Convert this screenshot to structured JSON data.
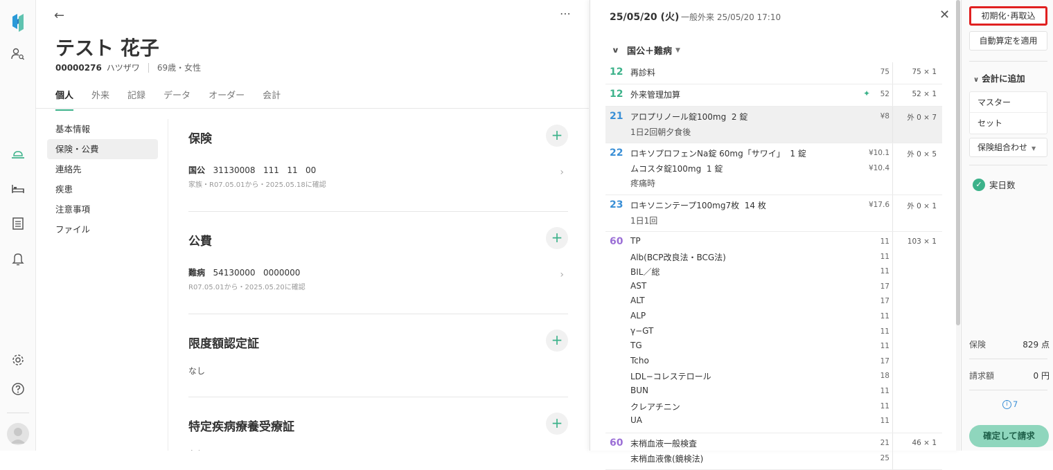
{
  "patient": {
    "name": "テスト 花子",
    "id": "00000276",
    "kana": "ハツザワ",
    "age_sex": "69歳・女性",
    "tabs": [
      "個人",
      "外来",
      "記録",
      "データ",
      "オーダー",
      "会計"
    ],
    "subnav": [
      "基本情報",
      "保険・公費",
      "連絡先",
      "疾患",
      "注意事項",
      "ファイル"
    ],
    "sections": {
      "insurance": {
        "title": "保険",
        "type": "国公",
        "numbers": "31130008   111   11   00",
        "sub": "家族・R07.05.01から・2025.05.18に確認"
      },
      "public": {
        "title": "公費",
        "type": "難病",
        "numbers": "54130000   0000000",
        "sub": "R07.05.01から・2025.05.20に確認"
      },
      "limit": {
        "title": "限度額認定証",
        "value": "なし"
      },
      "specific": {
        "title": "特定疾病療養受療証",
        "value": "なし"
      }
    }
  },
  "drawer": {
    "date": "25/05/20 (火)",
    "visit": "一般外来 25/05/20 17:10",
    "group_label": "国公＋難病",
    "items": [
      {
        "code": "12",
        "color": "#3cb28a",
        "lines": [
          "再診料"
        ],
        "pts": [
          "75"
        ],
        "qty": "75 × 1"
      },
      {
        "code": "12",
        "color": "#3cb28a",
        "lines": [
          "外来管理加算"
        ],
        "pts": [
          "52"
        ],
        "qty": "52 × 1"
      },
      {
        "code": "21",
        "color": "#3a8fd6",
        "lines": [
          "アロプリノール錠100mg  2 錠"
        ],
        "sub": "1日2回朝夕食後",
        "pts": [
          "¥8"
        ],
        "qty": "外 0 × 7"
      },
      {
        "code": "22",
        "color": "#3a8fd6",
        "lines": [
          "ロキソプロフェンNa錠 60mg「サワイ」  1 錠",
          "ムコスタ錠100mg  1 錠"
        ],
        "sub": "疼痛時",
        "pts": [
          "¥10.1",
          "¥10.4"
        ],
        "qty": "外 0 × 5"
      },
      {
        "code": "23",
        "color": "#3a8fd6",
        "lines": [
          "ロキソニンテープ100mg7枚  14 枚"
        ],
        "sub": "1日1回",
        "pts": [
          "¥17.6"
        ],
        "qty": "外 0 × 1"
      },
      {
        "code": "60",
        "color": "#9b6fd6",
        "lines": [
          "TP",
          "Alb(BCP改良法・BCG法)",
          "BIL／総",
          "AST",
          "ALT",
          "ALP",
          "γ−GT",
          "TG",
          "Tcho",
          "LDL−コレステロール",
          "BUN",
          "クレアチニン",
          "UA"
        ],
        "pts": [
          "11",
          "11",
          "11",
          "17",
          "17",
          "11",
          "11",
          "11",
          "17",
          "18",
          "11",
          "11",
          "11"
        ],
        "qty": "103 × 1"
      },
      {
        "code": "60",
        "color": "#9b6fd6",
        "lines": [
          "末梢血液一般検査",
          "末梢血液像(鏡検法)"
        ],
        "pts": [
          "21",
          "25"
        ],
        "qty": "46 × 1"
      }
    ]
  },
  "actions": {
    "reset_button": "初期化･再取込",
    "auto_button": "自動算定を適用",
    "add_heading": "会計に追加",
    "add_items": [
      "マスター",
      "セット"
    ],
    "combo_label": "保険組合わせ",
    "days_label": "実日数",
    "insurance_label": "保険",
    "insurance_value": "829 点",
    "billing_label": "請求額",
    "billing_value": "0 円",
    "info_count": "7",
    "confirm_button": "確定して請求",
    "accent_color": "#3cb28a",
    "highlight_color": "#e02020"
  }
}
